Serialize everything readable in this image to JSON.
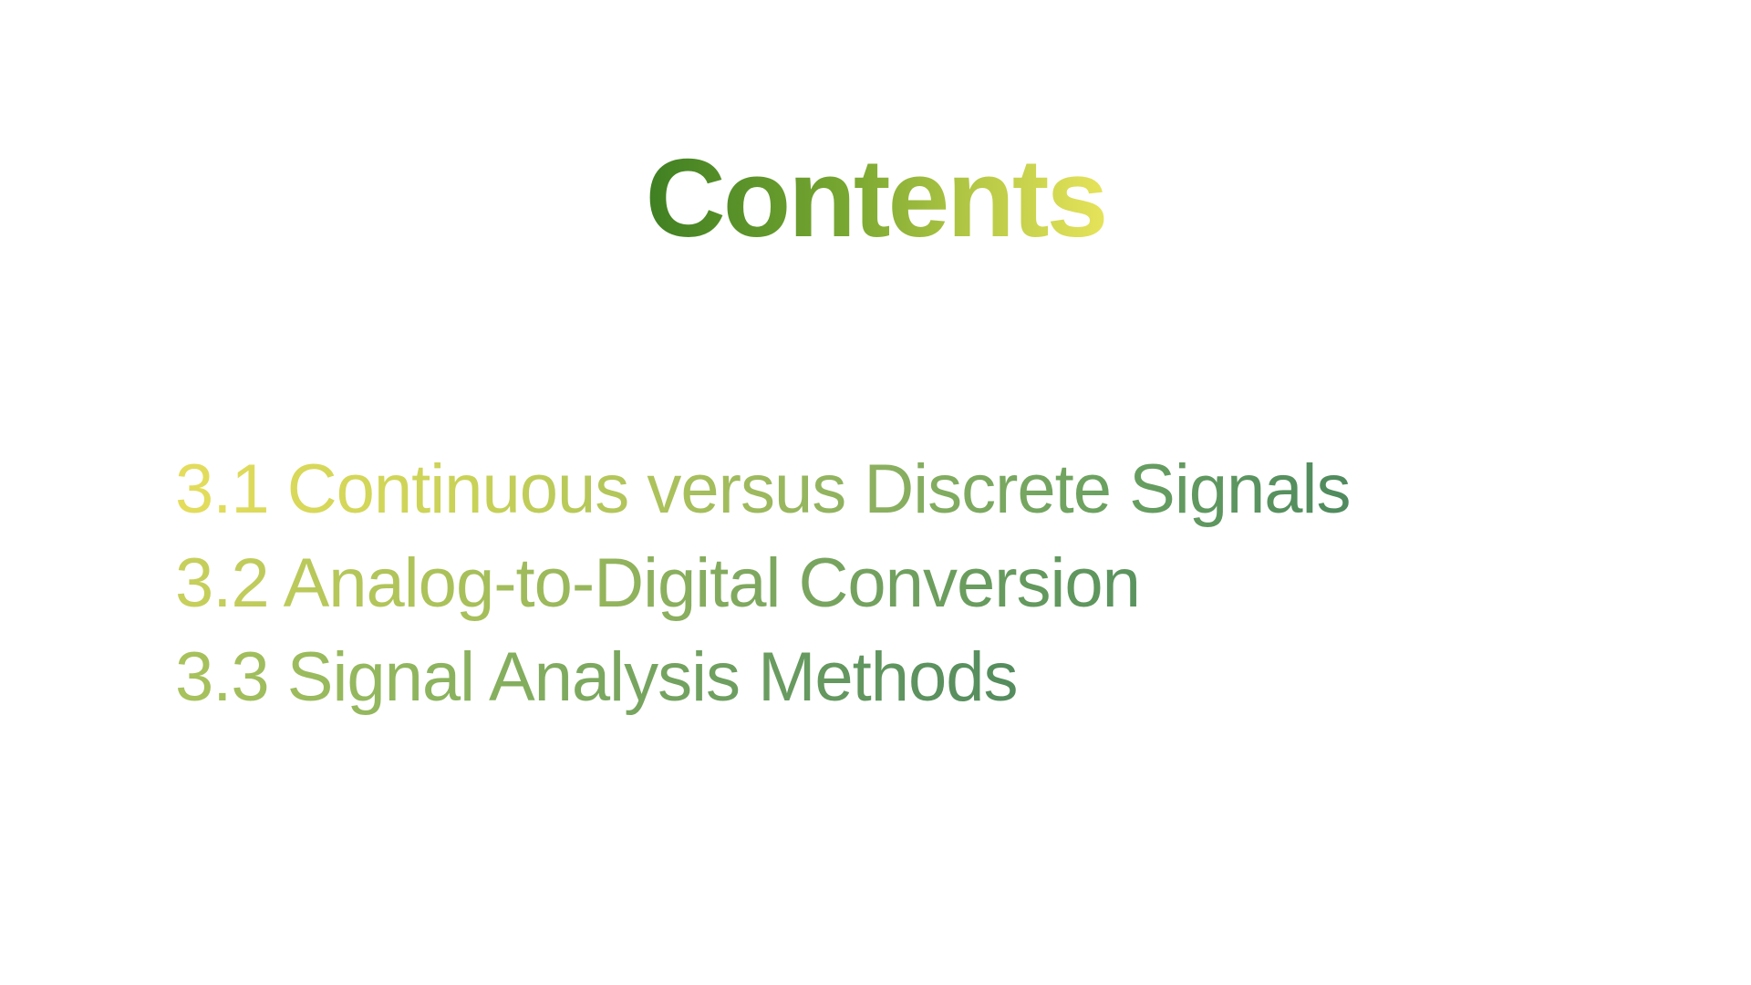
{
  "slide": {
    "title": "Contents",
    "items": [
      {
        "label": "3.1 Continuous versus Discrete Signals"
      },
      {
        "label": "3.2 Analog-to-Digital Conversion"
      },
      {
        "label": "3.3 Signal Analysis Methods"
      }
    ]
  },
  "colors": {
    "title_gradient": [
      "#3f7f22",
      "#e6e35a"
    ],
    "items_gradient": [
      "#e4dd5c",
      "#4f8a5e"
    ],
    "background": "#ffffff"
  }
}
